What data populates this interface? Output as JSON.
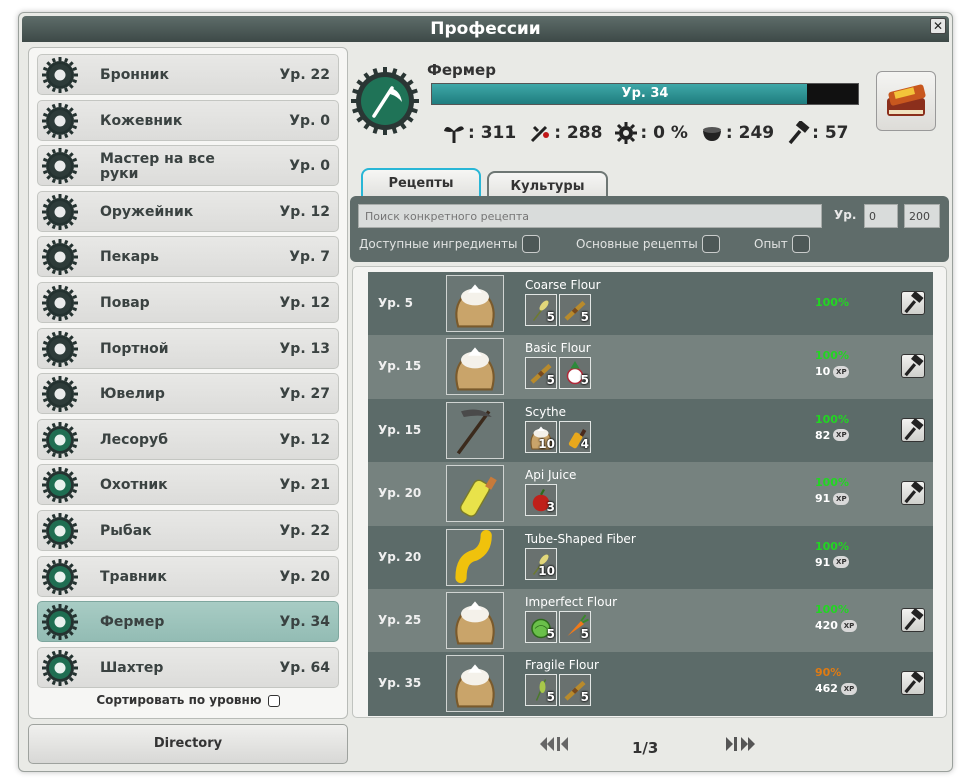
{
  "window": {
    "title": "Профессии",
    "close_label": "✕"
  },
  "professions": [
    {
      "name": "Бронник",
      "level": "Ур. 22",
      "icon": "armor-icon",
      "active": false
    },
    {
      "name": "Кожевник",
      "level": "Ур. 0",
      "icon": "leather-icon",
      "active": false
    },
    {
      "name": "Мастер на все руки",
      "level": "Ур. 0",
      "icon": "jack-of-all-trades-icon",
      "active": false
    },
    {
      "name": "Оружейник",
      "level": "Ур. 12",
      "icon": "weapon-icon",
      "active": false
    },
    {
      "name": "Пекарь",
      "level": "Ур. 7",
      "icon": "bread-icon",
      "active": false
    },
    {
      "name": "Повар",
      "level": "Ур. 12",
      "icon": "cook-icon",
      "active": false
    },
    {
      "name": "Портной",
      "level": "Ур. 13",
      "icon": "needle-icon",
      "active": false
    },
    {
      "name": "Ювелир",
      "level": "Ур. 27",
      "icon": "jewel-icon",
      "active": false
    },
    {
      "name": "Лесоруб",
      "level": "Ур. 12",
      "icon": "axe-icon",
      "active": false
    },
    {
      "name": "Охотник",
      "level": "Ур. 21",
      "icon": "hunter-icon",
      "active": false
    },
    {
      "name": "Рыбак",
      "level": "Ур. 22",
      "icon": "fishing-hook-icon",
      "active": false
    },
    {
      "name": "Травник",
      "level": "Ур. 20",
      "icon": "herb-icon",
      "active": false
    },
    {
      "name": "Фермер",
      "level": "Ур. 34",
      "icon": "scythe-icon",
      "active": true
    },
    {
      "name": "Шахтер",
      "level": "Ур. 64",
      "icon": "pickaxe-icon",
      "active": false
    }
  ],
  "sort_label": "Сортировать по уровню",
  "directory_label": "Directory",
  "header": {
    "job_name": "Фермер",
    "level_text": "Ур. 34",
    "xp_progress_percent": 88,
    "stats": [
      {
        "icon": "plant-icon",
        "value": ": 311"
      },
      {
        "icon": "harvest-icon",
        "value": ": 288"
      },
      {
        "icon": "gear-icon",
        "value": ": 0 %"
      },
      {
        "icon": "pot-icon",
        "value": ": 249"
      },
      {
        "icon": "hammer-icon",
        "value": ": 57"
      }
    ]
  },
  "tabs": [
    {
      "label": "Рецепты",
      "active": true
    },
    {
      "label": "Культуры",
      "active": false
    }
  ],
  "filter": {
    "search_placeholder": "Поиск конкретного рецепта",
    "level_label": "Ур.",
    "level_min": "0",
    "level_max": "200",
    "options": [
      "Доступные ингредиенты",
      "Основные рецепты",
      "Опыт"
    ]
  },
  "recipes": [
    {
      "level": "Ур. 5",
      "name": "Coarse Flour",
      "image": "flour-sack-icon",
      "ingredients": [
        {
          "icon": "wheat-icon",
          "qty": "5"
        },
        {
          "icon": "wheat-bundle-icon",
          "qty": "5"
        }
      ],
      "percent": "100%",
      "percent_color": "#22d622",
      "xp": "",
      "craftable": true
    },
    {
      "level": "Ур. 15",
      "name": "Basic Flour",
      "image": "flour-sack-icon",
      "ingredients": [
        {
          "icon": "wheat-bundle-icon",
          "qty": "5"
        },
        {
          "icon": "radish-icon",
          "qty": "5"
        }
      ],
      "percent": "100%",
      "percent_color": "#22d622",
      "xp": "10",
      "craftable": true
    },
    {
      "level": "Ур. 15",
      "name": "Scythe",
      "image": "scythe-icon",
      "ingredients": [
        {
          "icon": "flour-sack-icon",
          "qty": "10"
        },
        {
          "icon": "potion-icon",
          "qty": "4"
        }
      ],
      "percent": "100%",
      "percent_color": "#22d622",
      "xp": "82",
      "craftable": true
    },
    {
      "level": "Ур. 20",
      "name": "Api Juice",
      "image": "juice-bottle-icon",
      "ingredients": [
        {
          "icon": "apple-icon",
          "qty": "3"
        }
      ],
      "percent": "100%",
      "percent_color": "#22d622",
      "xp": "91",
      "craftable": true
    },
    {
      "level": "Ур. 20",
      "name": "Tube-Shaped Fiber",
      "image": "fiber-icon",
      "ingredients": [
        {
          "icon": "wheat-icon",
          "qty": "10"
        }
      ],
      "percent": "100%",
      "percent_color": "#22d622",
      "xp": "91",
      "craftable": false
    },
    {
      "level": "Ур. 25",
      "name": "Imperfect Flour",
      "image": "flour-sack-icon",
      "ingredients": [
        {
          "icon": "cabbage-icon",
          "qty": "5"
        },
        {
          "icon": "carrot-icon",
          "qty": "5"
        }
      ],
      "percent": "100%",
      "percent_color": "#22d622",
      "xp": "420",
      "craftable": true
    },
    {
      "level": "Ур. 35",
      "name": "Fragile Flour",
      "image": "flour-sack-icon",
      "ingredients": [
        {
          "icon": "herb-sprig-icon",
          "qty": "5"
        },
        {
          "icon": "wheat-bundle-icon",
          "qty": "5"
        }
      ],
      "percent": "90%",
      "percent_color": "#e07b12",
      "xp": "462",
      "craftable": true
    }
  ],
  "pager": {
    "page_text": "1/3"
  }
}
